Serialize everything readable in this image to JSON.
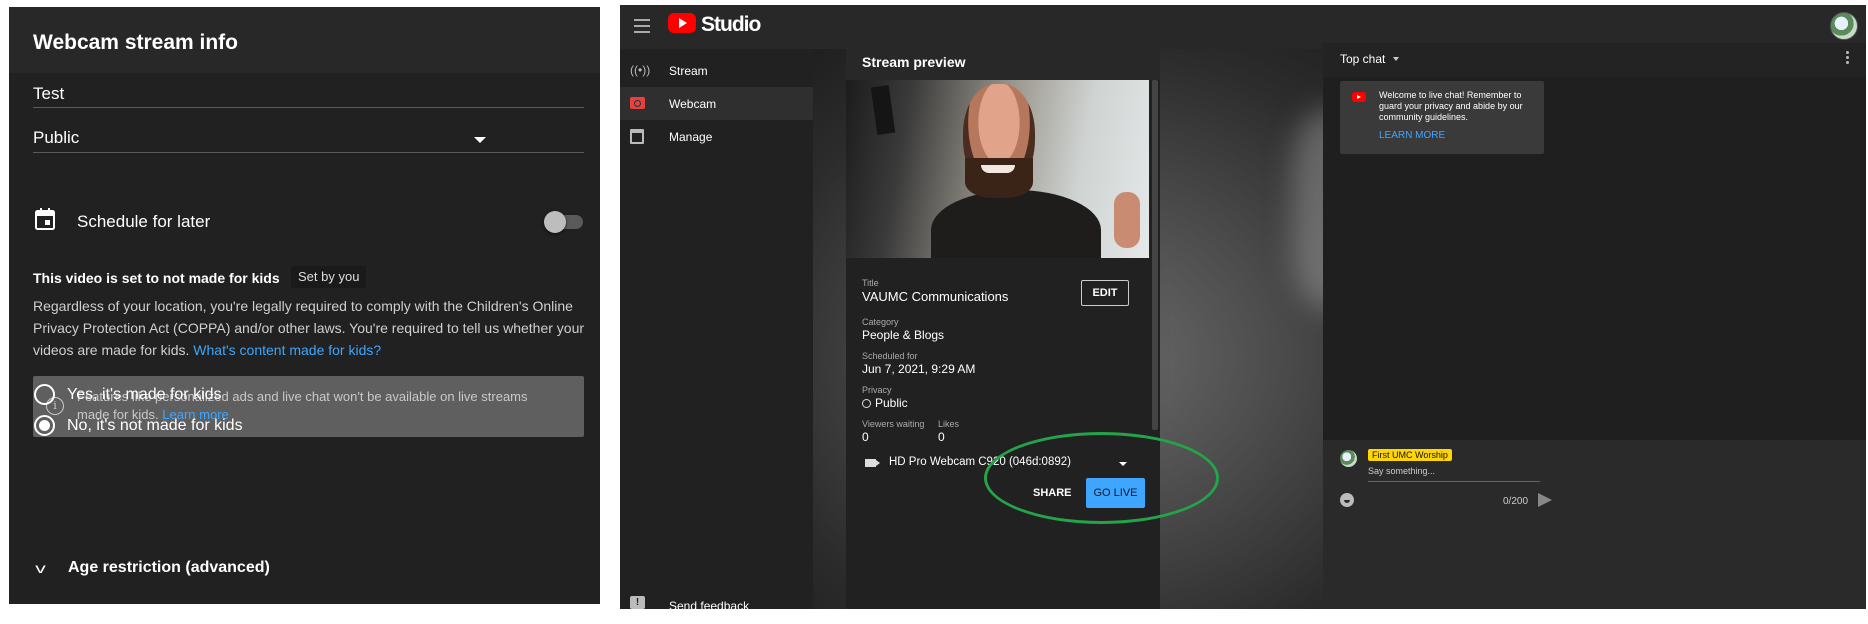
{
  "left_panel": {
    "title": "Webcam stream info",
    "title_field_value": "Test",
    "privacy_value": "Public",
    "schedule_label": "Schedule for later",
    "schedule_toggle": "off",
    "kids_heading": "This video is set to not made for kids",
    "set_by_badge": "Set by you",
    "coppa_text": "Regardless of your location, you're legally required to comply with the Children's Online Privacy Protection Act (COPPA) and/or other laws. You're required to tell us whether your videos are made for kids.",
    "coppa_link": "What's content made for kids?",
    "info_text": "Features like personalized ads and live chat won't be available on live streams made for kids.",
    "info_link": "Learn more",
    "option_yes": "Yes, it's made for kids",
    "option_no": "No, it's not made for kids",
    "selected_option": "no",
    "age_restriction": "Age restriction (advanced)"
  },
  "studio": {
    "brand": "Studio",
    "nav": [
      {
        "label": "Stream",
        "icon": "broadcast-icon"
      },
      {
        "label": "Webcam",
        "icon": "camera-icon",
        "active": true
      },
      {
        "label": "Manage",
        "icon": "calendar-icon"
      }
    ],
    "feedback_label": "Send feedback",
    "preview": {
      "title": "Stream preview",
      "title_label": "Title",
      "title_value": "VAUMC Communications",
      "edit_label": "EDIT",
      "category_label": "Category",
      "category_value": "People & Blogs",
      "scheduled_label": "Scheduled for",
      "scheduled_value": "Jun 7, 2021, 9:29 AM",
      "privacy_label": "Privacy",
      "privacy_value": "Public",
      "viewers_label": "Viewers waiting",
      "viewers_value": "0",
      "likes_label": "Likes",
      "likes_value": "0",
      "webcam_device": "HD Pro Webcam C920 (046d:0892)",
      "share_label": "SHARE",
      "golive_label": "GO LIVE"
    },
    "chat": {
      "mode": "Top chat",
      "welcome_text": "Welcome to live chat! Remember to guard your privacy and abide by our community guidelines.",
      "learn_more": "LEARN MORE",
      "author": "First UMC Worship",
      "placeholder": "Say something...",
      "char_count": "0/200"
    },
    "accent_color": "#3ea6ff",
    "highlight_color": "#23a34a"
  }
}
